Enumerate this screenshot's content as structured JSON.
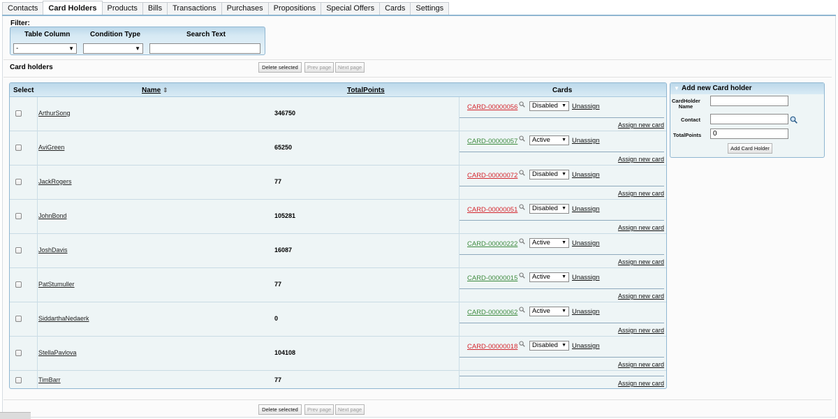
{
  "tabs": [
    {
      "label": "Contacts",
      "active": false
    },
    {
      "label": "Card Holders",
      "active": true
    },
    {
      "label": "Products",
      "active": false
    },
    {
      "label": "Bills",
      "active": false
    },
    {
      "label": "Transactions",
      "active": false
    },
    {
      "label": "Purchases",
      "active": false
    },
    {
      "label": "Propositions",
      "active": false
    },
    {
      "label": "Special Offers",
      "active": false
    },
    {
      "label": "Cards",
      "active": false
    },
    {
      "label": "Settings",
      "active": false
    }
  ],
  "filter": {
    "label": "Filter:",
    "table_column_header": "Table Column",
    "condition_type_header": "Condition Type",
    "search_text_header": "Search Text",
    "table_column_value": "-",
    "condition_type_value": "",
    "search_text_value": ""
  },
  "section_title": "Card holders",
  "pager": {
    "delete_selected": "Delete selected",
    "prev_page": "Prev page",
    "next_page": "Next page"
  },
  "table": {
    "headers": {
      "select": "Select",
      "name": "Name",
      "name_sort_icon": "⇕",
      "total_points": "TotalPoints",
      "cards": "Cards"
    },
    "assign_label": "Assign new card",
    "unassign_label": "Unassign",
    "rows": [
      {
        "name": "ArthurSong",
        "points": "346750",
        "card": "CARD-00000056",
        "status": "Disabled"
      },
      {
        "name": "AviGreen",
        "points": "65250",
        "card": "CARD-00000057",
        "status": "Active"
      },
      {
        "name": "JackRogers",
        "points": "77",
        "card": "CARD-00000072",
        "status": "Disabled"
      },
      {
        "name": "JohnBond",
        "points": "105281",
        "card": "CARD-00000051",
        "status": "Disabled"
      },
      {
        "name": "JoshDavis",
        "points": "16087",
        "card": "CARD-00000222",
        "status": "Active"
      },
      {
        "name": "PatStumuller",
        "points": "77",
        "card": "CARD-00000015",
        "status": "Active"
      },
      {
        "name": "SiddarthaNedaerk",
        "points": "0",
        "card": "CARD-00000062",
        "status": "Active"
      },
      {
        "name": "StellaPavlova",
        "points": "104108",
        "card": "CARD-00000018",
        "status": "Disabled"
      },
      {
        "name": "TimBarr",
        "points": "77",
        "card": "",
        "status": ""
      }
    ]
  },
  "add_panel": {
    "title": "Add new Card holder",
    "holder_name_label": "CardHolder Name",
    "holder_name_value": "",
    "contact_label": "Contact",
    "contact_value": "",
    "total_points_label": "TotalPoints",
    "total_points_value": "0",
    "add_button": "Add Card Holder"
  },
  "colors": {
    "accent": "#8fb6d1",
    "status_disabled": "#d4262d",
    "status_active": "#3e8b3e"
  }
}
